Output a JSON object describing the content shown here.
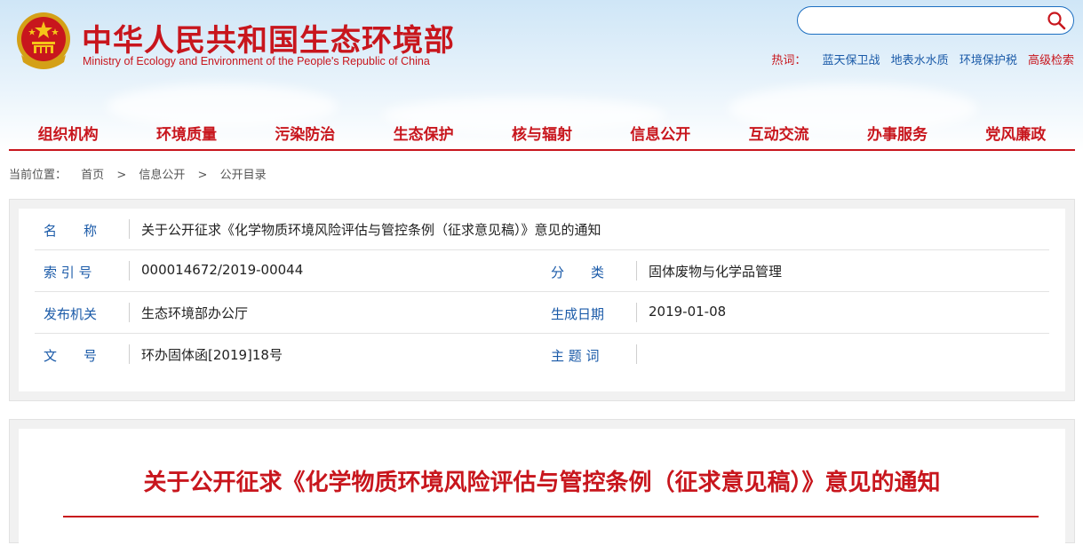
{
  "header": {
    "title": "中华人民共和国生态环境部",
    "subtitle": "Ministry of Ecology and Environment of the People's Republic of China",
    "search_placeholder": "",
    "hot_label": "热词：",
    "hot_links": [
      "蓝天保卫战",
      "地表水水质",
      "环境保护税"
    ],
    "advanced_search": "高级检索"
  },
  "nav": [
    "组织机构",
    "环境质量",
    "污染防治",
    "生态保护",
    "核与辐射",
    "信息公开",
    "互动交流",
    "办事服务",
    "党风廉政"
  ],
  "breadcrumb": {
    "label": "当前位置：",
    "items": [
      "首页",
      "信息公开",
      "公开目录"
    ],
    "separator": ">"
  },
  "meta": {
    "name_label": "名　　称",
    "name_value": "关于公开征求《化学物质环境风险评估与管控条例（征求意见稿）》意见的通知",
    "index_label": "索 引 号",
    "index_value": "000014672/2019-00044",
    "category_label": "分　　类",
    "category_value": "固体废物与化学品管理",
    "publisher_label": "发布机关",
    "publisher_value": "生态环境部办公厅",
    "date_label": "生成日期",
    "date_value": "2019-01-08",
    "docno_label": "文　　号",
    "docno_value": "环办固体函[2019]18号",
    "keywords_label": "主 题 词",
    "keywords_value": ""
  },
  "article": {
    "title": "关于公开征求《化学物质环境风险评估与管控条例（征求意见稿）》意见的通知"
  },
  "colors": {
    "brand_red": "#c8161d",
    "link_blue": "#1a5aa8"
  }
}
